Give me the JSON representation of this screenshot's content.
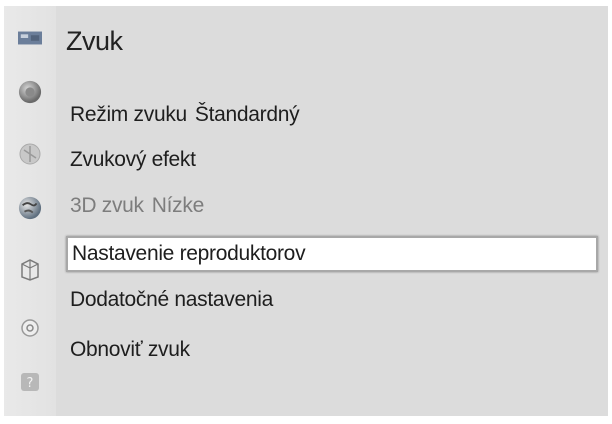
{
  "menu": {
    "title": "Zvuk",
    "items": [
      {
        "label": "Režim zvuku",
        "value": "Štandardný",
        "state": "normal"
      },
      {
        "label": "Zvukový efekt",
        "value": "",
        "state": "normal"
      },
      {
        "label": "3D zvuk",
        "value": "Nízke",
        "state": "disabled"
      },
      {
        "label": "Nastavenie reproduktorov",
        "value": "",
        "state": "selected"
      },
      {
        "label": "Dodatočné nastavenia",
        "value": "",
        "state": "normal"
      },
      {
        "label": "Obnoviť zvuk",
        "value": "",
        "state": "normal"
      }
    ]
  },
  "sidebar": {
    "icons": [
      "picture-icon",
      "sound-icon",
      "channel-icon",
      "network-icon",
      "system-icon",
      "settings-icon",
      "support-icon"
    ]
  },
  "colors": {
    "panel": "#dcdcdc",
    "selected_bg": "#ffffff",
    "disabled_text": "#7d7d7d"
  }
}
